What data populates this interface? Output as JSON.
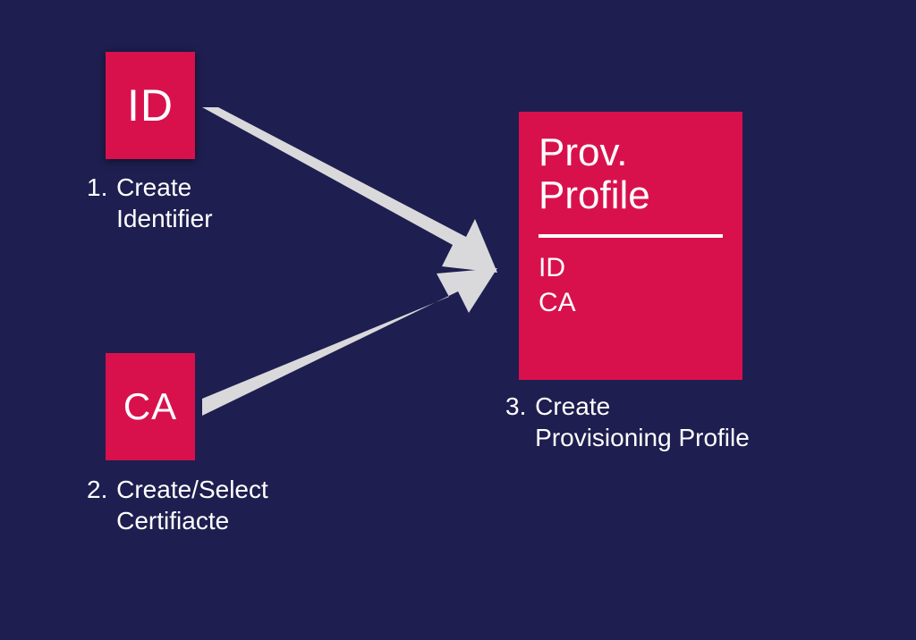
{
  "boxes": {
    "id": {
      "label": "ID"
    },
    "ca": {
      "label": "CA"
    },
    "prov": {
      "title_line1": "Prov.",
      "title_line2": "Profile",
      "sub1": "ID",
      "sub2": "CA"
    }
  },
  "captions": {
    "id": {
      "num": "1.",
      "line1": "Create",
      "line2": "Identifier"
    },
    "ca": {
      "num": "2.",
      "line1": "Create/Select",
      "line2": "Certifiacte"
    },
    "prov": {
      "num": "3.",
      "line1": "Create",
      "line2": "Provisioning Profile"
    }
  },
  "colors": {
    "background": "#1e1e50",
    "box": "#d8114d",
    "arrow": "#d9d9db",
    "text": "#ffffff"
  }
}
